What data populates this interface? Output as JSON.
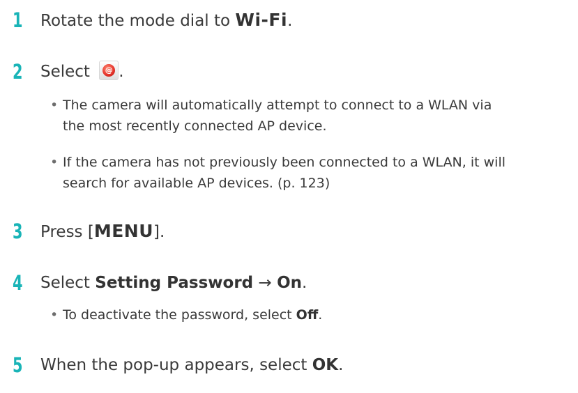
{
  "steps": [
    {
      "number": "1",
      "prefix": "Rotate the mode dial to ",
      "mode": "Wi-Fi",
      "suffix": "."
    },
    {
      "number": "2",
      "prefix": "Select ",
      "icon": "email-icon",
      "icon_text": "@",
      "suffix": "."
    },
    {
      "number": "3",
      "prefix": "Press [",
      "key": "MENU",
      "suffix": "]."
    },
    {
      "number": "4",
      "prefix": "Select ",
      "bold1": "Setting Password",
      "arrow": " → ",
      "bold2": "On",
      "suffix": "."
    },
    {
      "number": "5",
      "prefix": "When the pop-up appears, select ",
      "bold": "OK",
      "suffix": "."
    }
  ],
  "bullets": {
    "step2": [
      {
        "line1": "The camera will automatically attempt to connect to a WLAN via",
        "line2": "the most recently connected AP device."
      },
      {
        "line1": "If the camera has not previously been connected to a WLAN, it will",
        "line2": "search for available AP devices. (p. 123)"
      }
    ],
    "step4": [
      {
        "prefix": "To deactivate the password, select ",
        "bold": "Off",
        "suffix": "."
      }
    ]
  },
  "colors": {
    "step_number": "#19b4b7",
    "text": "#3a3a3a",
    "icon_red": "#e6332a"
  }
}
